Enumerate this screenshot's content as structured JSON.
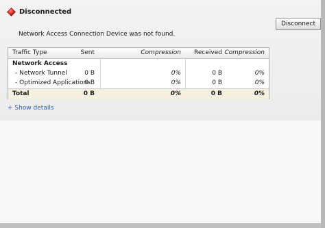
{
  "status": {
    "label": "Disconnected",
    "icon": "red-diamond-icon",
    "color": "#d11a1a"
  },
  "disconnect_button": {
    "label": "Disconnect"
  },
  "message": "Network Access Connection Device was not found.",
  "table": {
    "headers": [
      "Traffic Type",
      "Sent",
      "Compression",
      "Received",
      "Compression"
    ],
    "group_label": "Network Access",
    "rows": [
      {
        "type": "- Network Tunnel",
        "sent": "0 B",
        "sent_comp": "0%",
        "received": "0 B",
        "received_comp": "0%"
      },
      {
        "type": "- Optimized Applications",
        "sent": "0 B",
        "sent_comp": "0%",
        "received": "0 B",
        "received_comp": "0%"
      }
    ],
    "total": {
      "type": "Total",
      "sent": "0 B",
      "sent_comp": "0%",
      "received": "0 B",
      "received_comp": "0%"
    }
  },
  "show_details_link": "+ Show details",
  "colors": {
    "link": "#2a63b3",
    "total_row_bg": "#f4f1e1"
  }
}
